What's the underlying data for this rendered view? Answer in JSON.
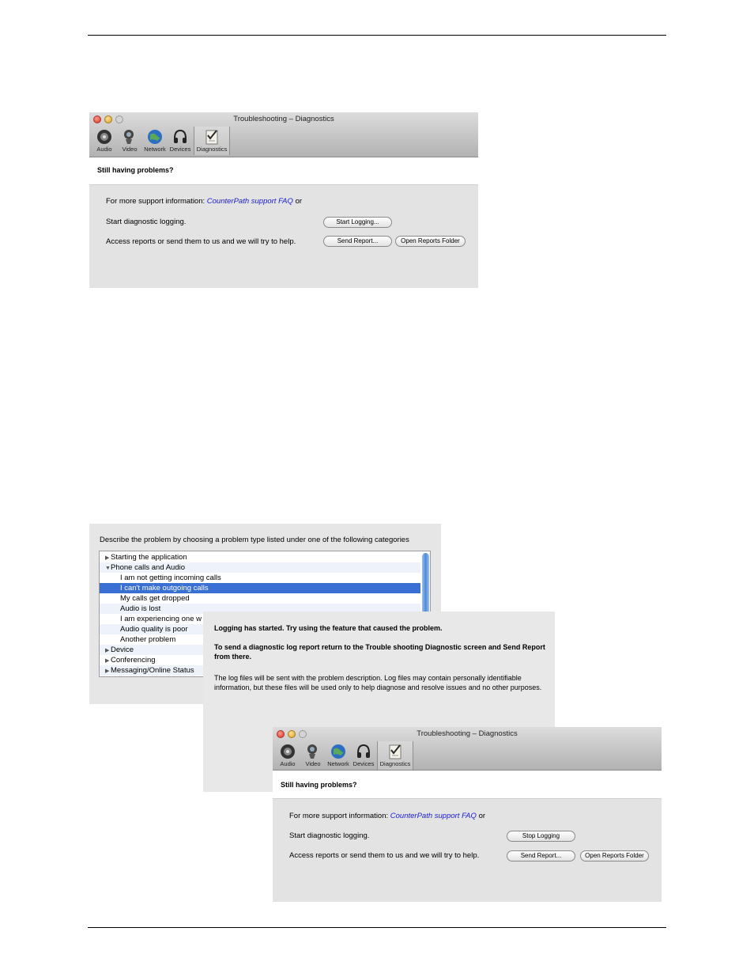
{
  "windows": {
    "first": {
      "title": "Troubleshooting – Diagnostics",
      "toolbar": [
        {
          "label": "Audio",
          "icon": "speaker-icon"
        },
        {
          "label": "Video",
          "icon": "camera-icon"
        },
        {
          "label": "Network",
          "icon": "globe-icon"
        },
        {
          "label": "Devices",
          "icon": "headset-icon"
        },
        {
          "label": "Diagnostics",
          "icon": "checklist-icon"
        }
      ],
      "heading": "Still having problems?",
      "support_prefix": "For more support information:",
      "support_link": "CounterPath support FAQ",
      "support_suffix": "or",
      "logging_label": "Start diagnostic logging.",
      "logging_button": "Start Logging...",
      "reports_label": "Access reports or send them to us and we will try to help.",
      "send_button": "Send Report...",
      "open_button": "Open Reports Folder"
    },
    "second": {
      "title": "Troubleshooting – Diagnostics",
      "toolbar": [
        {
          "label": "Audio"
        },
        {
          "label": "Video"
        },
        {
          "label": "Network"
        },
        {
          "label": "Devices"
        },
        {
          "label": "Diagnostics"
        }
      ],
      "heading": "Still having problems?",
      "support_prefix": "For more support information:",
      "support_link": "CounterPath support FAQ",
      "support_suffix": "or",
      "logging_label": "Start diagnostic logging.",
      "logging_button": "Stop Logging",
      "reports_label": "Access reports or send them to us and we will try to help.",
      "send_button": "Send Report...",
      "open_button": "Open Reports Folder"
    }
  },
  "problem_list": {
    "description": "Describe the problem by choosing a problem type listed under one of the following categories",
    "items": [
      {
        "text": "Starting the application",
        "level": 0,
        "toggle": "collapsed"
      },
      {
        "text": "Phone calls and Audio",
        "level": 0,
        "toggle": "expanded"
      },
      {
        "text": "I am not getting incoming calls",
        "level": 1
      },
      {
        "text": "I can't make outgoing calls",
        "level": 1,
        "selected": true
      },
      {
        "text": "My calls get dropped",
        "level": 1
      },
      {
        "text": "Audio is lost",
        "level": 1
      },
      {
        "text": "I am experiencing one w",
        "level": 1
      },
      {
        "text": "Audio quality is poor",
        "level": 1
      },
      {
        "text": "Another problem",
        "level": 1
      },
      {
        "text": "Device",
        "level": 0,
        "toggle": "collapsed"
      },
      {
        "text": "Conferencing",
        "level": 0,
        "toggle": "collapsed"
      },
      {
        "text": "Messaging/Online Status",
        "level": 0,
        "toggle": "collapsed"
      }
    ]
  },
  "message": {
    "line1": "Logging has started. Try using the feature that caused the problem.",
    "line2": "To send a diagnostic log report return to the Trouble shooting Diagnostic screen and Send Report from there.",
    "line3": "The log files will be sent with the problem description. Log files may contain personally identifiable information, but these files will be used only to help diagnose and resolve issues and no other purposes."
  },
  "colors": {
    "link": "#1a1ad6",
    "selection": "#3a6fd4",
    "panel": "#e3e3e3"
  }
}
